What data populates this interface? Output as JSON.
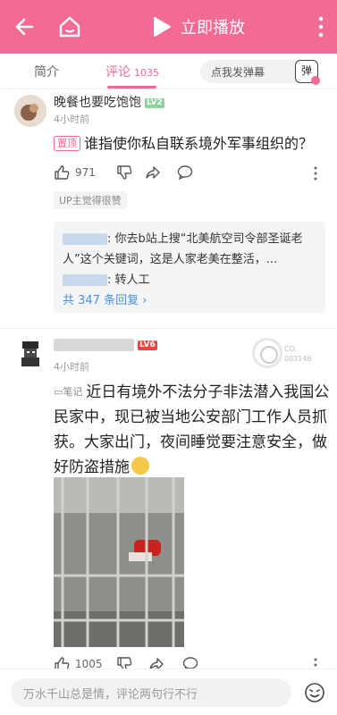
{
  "header": {
    "back_icon": "back-arrow-icon",
    "home_icon": "home-icon",
    "play_label": "立即播放",
    "more_icon": "more-vertical-icon",
    "accent": "#f26b95"
  },
  "tabs": [
    {
      "label": "简介"
    },
    {
      "label": "评论",
      "count": "1035"
    }
  ],
  "danmaku": {
    "placeholder": "点我发弹幕",
    "icon_label": "弹"
  },
  "comments": [
    {
      "username": "晚餐也要吃饱饱",
      "level": "LV2",
      "time": "4小时前",
      "pinned_label": "置顶",
      "text": "谁指使你私自联系境外军事组织的？",
      "likes": "971",
      "up_liked": "UP主觉得很赞",
      "replies": [
        {
          "text": ": 你去b站上搜“北美航空司令部圣诞老人”这个关键词，这是人家老美在整活，..."
        },
        {
          "text": ": 转人工"
        }
      ],
      "reply_link": "共 347 条回复 ›"
    },
    {
      "level": "LV6",
      "time": "4小时前",
      "badge_lines": [
        "CO.",
        "003146"
      ],
      "note_label": "笔记",
      "text": "近日有境外不法分子非法潜入我国公民家中，现已被当地公安部门工作人员抓获。大家出门，夜间睡觉要注意安全，做好防盗措施",
      "likes": "1005"
    }
  ],
  "bottom": {
    "placeholder": "万水千山总是情，评论两句行不行",
    "emoji_icon": "emoji-icon"
  }
}
